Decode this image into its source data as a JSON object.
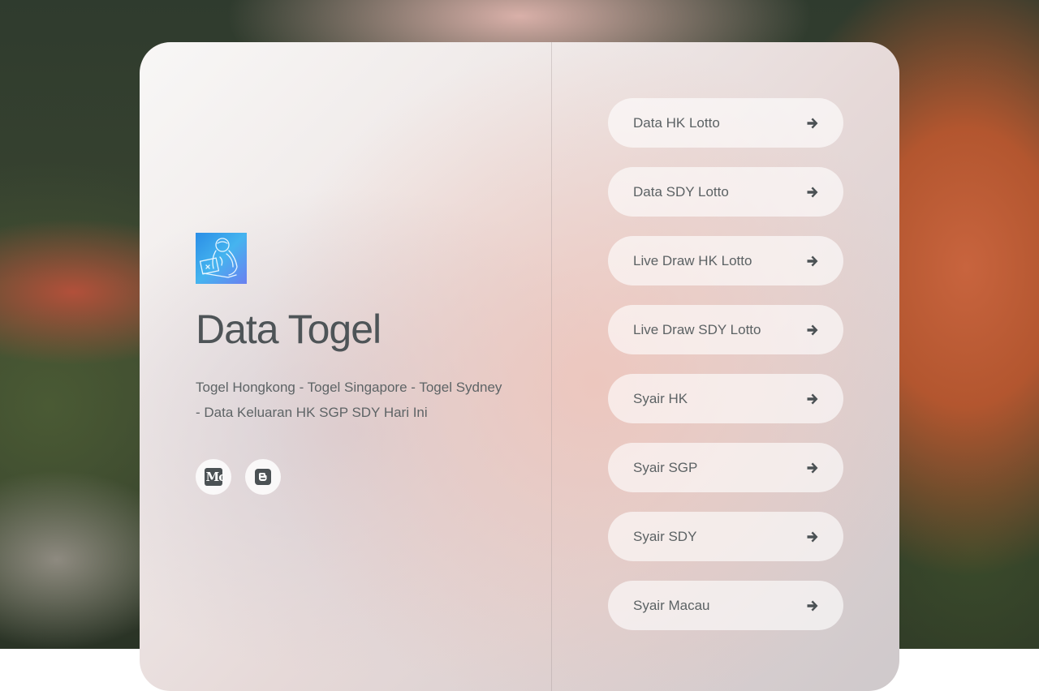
{
  "profile": {
    "title": "Data Togel",
    "description": "Togel Hongkong - Togel Singapore - Togel Sydney - Data Keluaran HK SGP SDY Hari Ini"
  },
  "socials": [
    {
      "icon": "medium-icon",
      "label": "Mc"
    },
    {
      "icon": "blogger-icon",
      "label": ""
    }
  ],
  "links": [
    {
      "label": "Data HK Lotto"
    },
    {
      "label": "Data SDY Lotto"
    },
    {
      "label": "Live Draw HK Lotto"
    },
    {
      "label": "Live Draw SDY Lotto"
    },
    {
      "label": "Syair HK"
    },
    {
      "label": "Syair SGP"
    },
    {
      "label": "Syair SDY"
    },
    {
      "label": "Syair Macau"
    }
  ],
  "colors": {
    "text": "#4e5457",
    "icon": "#4b5154",
    "logo_gradient_start": "#2b8ee6",
    "logo_gradient_end": "#6a7ff0"
  }
}
